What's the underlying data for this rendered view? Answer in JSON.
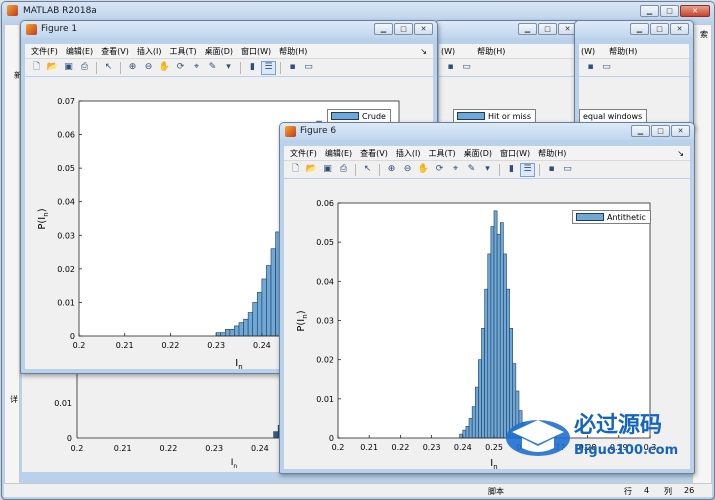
{
  "main_window": {
    "title": "MATLAB R2018a",
    "side_labels": {
      "left_top": "新",
      "left_mid": "详",
      "right_top": "索"
    },
    "status": {
      "label_script": "脚本",
      "label_row": "行",
      "row_value": "4",
      "label_col": "列",
      "col_value": "26"
    }
  },
  "menu": {
    "file": "文件(F)",
    "edit": "编辑(E)",
    "view": "查看(V)",
    "insert": "插入(I)",
    "tools": "工具(T)",
    "desktop": "桌面(D)",
    "window": "窗口(W)",
    "help": "帮助(H)"
  },
  "menu_partial": {
    "window": "(W)",
    "help": "帮助(H)"
  },
  "figures": {
    "figure1": {
      "title": "Figure 1",
      "legend": "Crude"
    },
    "figure_hit": {
      "legend": "Hit or miss"
    },
    "figure_equal": {
      "legend": "equal windows"
    },
    "figure6": {
      "title": "Figure 6",
      "legend": "Antithetic"
    }
  },
  "axes_text": {
    "ylabel": "P(I",
    "ylabel_sub": "n",
    "ylabel_close": ")",
    "xlabel": "I",
    "xlabel_sub": "n"
  },
  "chart_data": [
    {
      "type": "bar",
      "chart": "Figure 1",
      "series": [
        {
          "name": "Crude"
        }
      ],
      "xlim": [
        0.2,
        0.27
      ],
      "ylim": [
        0,
        0.07
      ],
      "xticks": [
        "0.2",
        "0.21",
        "0.22",
        "0.23",
        "0.24",
        "0.25",
        "0.26"
      ],
      "yticks": [
        "0",
        "0.01",
        "0.02",
        "0.03",
        "0.04",
        "0.05",
        "0.06",
        "0.07"
      ],
      "bins_x": [
        0.23,
        0.231,
        0.232,
        0.233,
        0.234,
        0.235,
        0.236,
        0.237,
        0.238,
        0.239,
        0.24,
        0.241,
        0.242,
        0.243,
        0.244,
        0.245,
        0.246,
        0.247,
        0.248,
        0.249,
        0.25,
        0.251,
        0.252,
        0.253,
        0.254,
        0.255,
        0.256,
        0.257,
        0.258,
        0.259,
        0.26,
        0.261,
        0.262,
        0.263,
        0.264,
        0.265,
        0.266,
        0.267,
        0.268,
        0.269
      ],
      "bins_y": [
        0.001,
        0.001,
        0.002,
        0.002,
        0.003,
        0.004,
        0.005,
        0.007,
        0.01,
        0.013,
        0.017,
        0.021,
        0.026,
        0.031,
        0.037,
        0.042,
        0.048,
        0.052,
        0.057,
        0.06,
        0.063,
        0.061,
        0.064,
        0.06,
        0.058,
        0.054,
        0.049,
        0.044,
        0.039,
        0.033,
        0.028,
        0.023,
        0.018,
        0.014,
        0.011,
        0.008,
        0.006,
        0.004,
        0.003,
        0.002
      ]
    },
    {
      "type": "bar",
      "chart": "Figure 6",
      "series": [
        {
          "name": "Antithetic"
        }
      ],
      "xlim": [
        0.2,
        0.3
      ],
      "ylim": [
        0,
        0.06
      ],
      "xticks": [
        "0.2",
        "0.21",
        "0.22",
        "0.23",
        "0.24",
        "0.25",
        "0.26",
        "0.27",
        "0.28",
        "0.29",
        "0.3"
      ],
      "yticks": [
        "0",
        "0.01",
        "0.02",
        "0.03",
        "0.04",
        "0.05",
        "0.06"
      ],
      "bins_x": [
        0.239,
        0.24,
        0.241,
        0.242,
        0.243,
        0.244,
        0.245,
        0.246,
        0.247,
        0.248,
        0.249,
        0.25,
        0.251,
        0.252,
        0.253,
        0.254,
        0.255,
        0.256,
        0.257,
        0.258,
        0.259,
        0.26,
        0.261
      ],
      "bins_y": [
        0.001,
        0.002,
        0.003,
        0.005,
        0.008,
        0.013,
        0.02,
        0.028,
        0.038,
        0.047,
        0.054,
        0.058,
        0.052,
        0.055,
        0.047,
        0.038,
        0.028,
        0.019,
        0.012,
        0.007,
        0.004,
        0.002,
        0.001
      ]
    },
    {
      "type": "bar",
      "chart": "background figure (partially visible)",
      "xticks": [
        "0.2",
        "0.21",
        "0.22",
        "0.23",
        "0.24",
        "0.25",
        "0.26"
      ],
      "yticks": [
        "0",
        "0.01"
      ],
      "bins_x": [
        0.243,
        0.244,
        0.245,
        0.246,
        0.247,
        0.248,
        0.249,
        0.25,
        0.251,
        0.252,
        0.253,
        0.254,
        0.255,
        0.256,
        0.257,
        0.258
      ],
      "bins_y": [
        0.002,
        0.004,
        0.008,
        0.013,
        0.018,
        0.022,
        0.024,
        0.025,
        0.023,
        0.024,
        0.02,
        0.016,
        0.011,
        0.007,
        0.004,
        0.002
      ]
    }
  ],
  "watermark": {
    "brand": "必过源码",
    "url": "Biguo100.com"
  },
  "colors": {
    "bar_fill": "#6fa8d6",
    "bar_edge": "#1f3c5a",
    "window_frame": "#b9d1ea"
  }
}
